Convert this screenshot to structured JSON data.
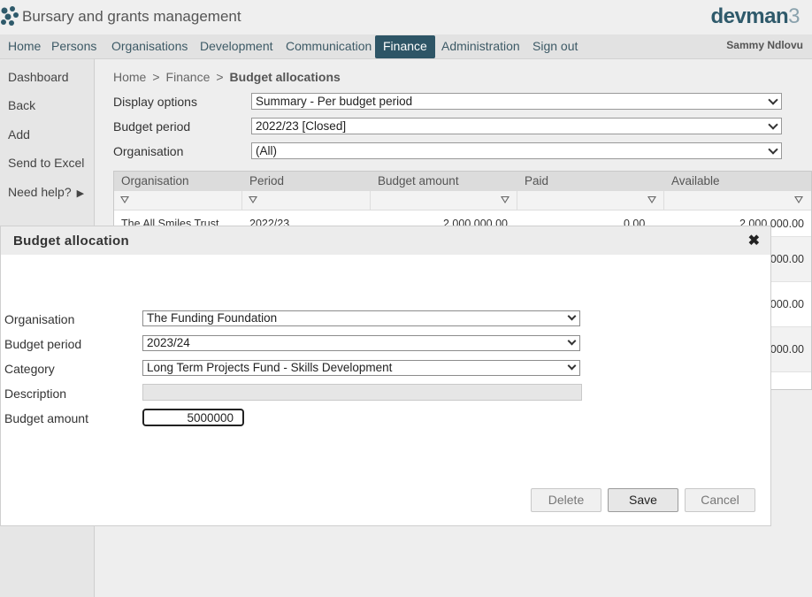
{
  "header": {
    "app_title": "Bursary and grants management",
    "brand_text": "devman",
    "brand_number": "3"
  },
  "nav": {
    "items": [
      {
        "label": "Home"
      },
      {
        "label": "Persons"
      },
      {
        "label": "Organisations"
      },
      {
        "label": "Development"
      },
      {
        "label": "Communication"
      },
      {
        "label": "Finance"
      },
      {
        "label": "Administration"
      },
      {
        "label": "Sign out"
      }
    ],
    "active": "Finance",
    "user": "Sammy Ndlovu"
  },
  "sidebar": {
    "items": [
      {
        "label": "Dashboard"
      },
      {
        "label": "Back"
      },
      {
        "label": "Add"
      },
      {
        "label": "Send to Excel"
      },
      {
        "label": "Need help?"
      }
    ],
    "help_arrow": "▶"
  },
  "breadcrumb": {
    "home": "Home",
    "section": "Finance",
    "current": "Budget allocations",
    "separator": ">"
  },
  "options": {
    "display_label": "Display options",
    "display_value": "Summary - Per budget period",
    "period_label": "Budget period",
    "period_value": "2022/23 [Closed]",
    "org_label": "Organisation",
    "org_value": "(All)"
  },
  "grid": {
    "columns": [
      "Organisation",
      "Period",
      "Budget amount",
      "Paid",
      "Available"
    ],
    "rows": [
      {
        "organisation": "The All Smiles Trust",
        "period": "2022/23",
        "budget": "2,000,000.00",
        "paid": "0.00",
        "available": "2,000,000.00"
      },
      {
        "available": "000.00"
      },
      {
        "available": "000.00"
      },
      {
        "available": "000.00"
      }
    ]
  },
  "modal": {
    "title": "Budget allocation",
    "close_glyph": "✖",
    "org_label": "Organisation",
    "org_value": "The Funding Foundation",
    "period_label": "Budget period",
    "period_value": "2023/24",
    "category_label": "Category",
    "category_value": "Long Term Projects Fund - Skills Development",
    "description_label": "Description",
    "description_value": "",
    "amount_label": "Budget amount",
    "amount_value": "5000000",
    "delete_label": "Delete",
    "save_label": "Save",
    "cancel_label": "Cancel"
  },
  "colors": {
    "accent": "#2e5566",
    "brand": "#2f5a6b"
  },
  "icons": {
    "logo": "devman-logo-icon",
    "filter": "filter-icon",
    "close": "close-icon",
    "dropdown": "chevron-down-icon"
  }
}
